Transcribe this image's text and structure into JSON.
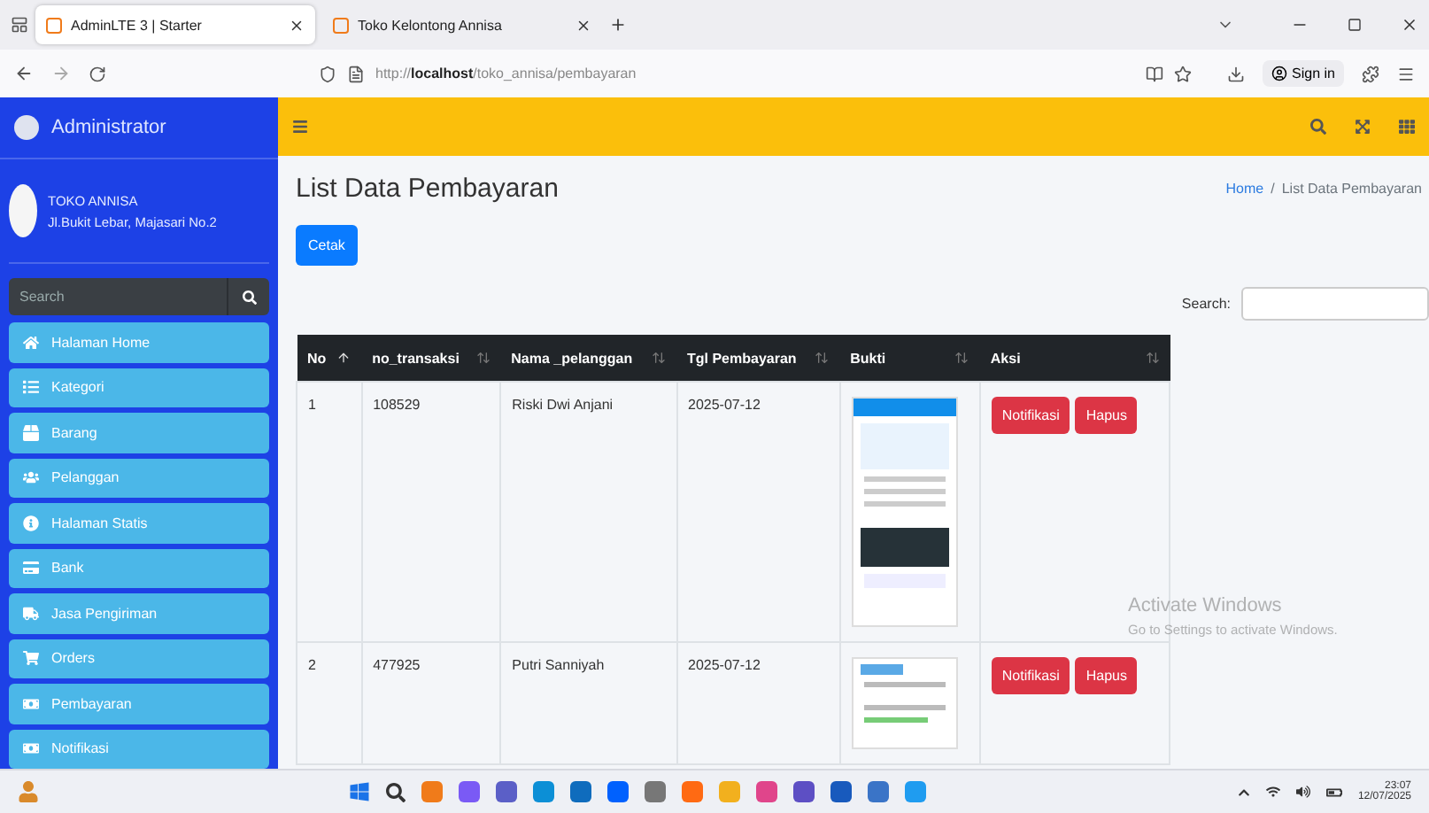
{
  "browser": {
    "tabs": [
      {
        "title": "AdminLTE 3 | Starter",
        "selected": true
      },
      {
        "title": "Toko Kelontong Annisa",
        "selected": false
      }
    ],
    "url": {
      "scheme": "http://",
      "host": "localhost",
      "path": "/toko_annisa/pembayaran"
    },
    "sign_in": "Sign in"
  },
  "sidebar": {
    "brand": "Administrator",
    "user": {
      "name": "TOKO ANNISA",
      "address": "Jl.Bukit Lebar, Majasari No.2"
    },
    "search": {
      "placeholder": "Search"
    },
    "items": [
      {
        "label": "Halaman Home"
      },
      {
        "label": "Kategori"
      },
      {
        "label": "Barang"
      },
      {
        "label": "Pelanggan"
      },
      {
        "label": "Halaman Statis"
      },
      {
        "label": "Bank"
      },
      {
        "label": "Jasa Pengiriman"
      },
      {
        "label": "Orders"
      },
      {
        "label": "Pembayaran"
      },
      {
        "label": "Notifikasi"
      }
    ]
  },
  "page": {
    "title": "List Data Pembayaran",
    "breadcrumb": [
      {
        "label": "Home",
        "link": true
      },
      {
        "label": "List Data Pembayaran",
        "link": false
      }
    ],
    "breadcrumb_separator": "/",
    "print_button": "Cetak",
    "search_label": "Search:",
    "table": {
      "columns": [
        {
          "label": "No",
          "sorted": true
        },
        {
          "label": "no_transaksi",
          "sorted": false
        },
        {
          "label": "Nama _pelanggan",
          "sorted": false
        },
        {
          "label": "Tgl Pembayaran",
          "sorted": false
        },
        {
          "label": "Bukti",
          "sorted": false
        },
        {
          "label": "Aksi",
          "sorted": false
        }
      ],
      "rows": [
        {
          "no": "1",
          "no_transaksi": "108529",
          "nama": "Riski Dwi Anjani",
          "tgl": "2025-07-12",
          "actions": [
            "Notifikasi",
            "Hapus"
          ]
        },
        {
          "no": "2",
          "no_transaksi": "477925",
          "nama": "Putri Sanniyah",
          "tgl": "2025-07-12",
          "actions": [
            "Notifikasi",
            "Hapus"
          ]
        }
      ]
    }
  },
  "activation": {
    "title": "Activate Windows",
    "subtitle": "Go to Settings to activate Windows."
  },
  "taskbar": {
    "time": "23:07",
    "date": "12/07/2025"
  }
}
